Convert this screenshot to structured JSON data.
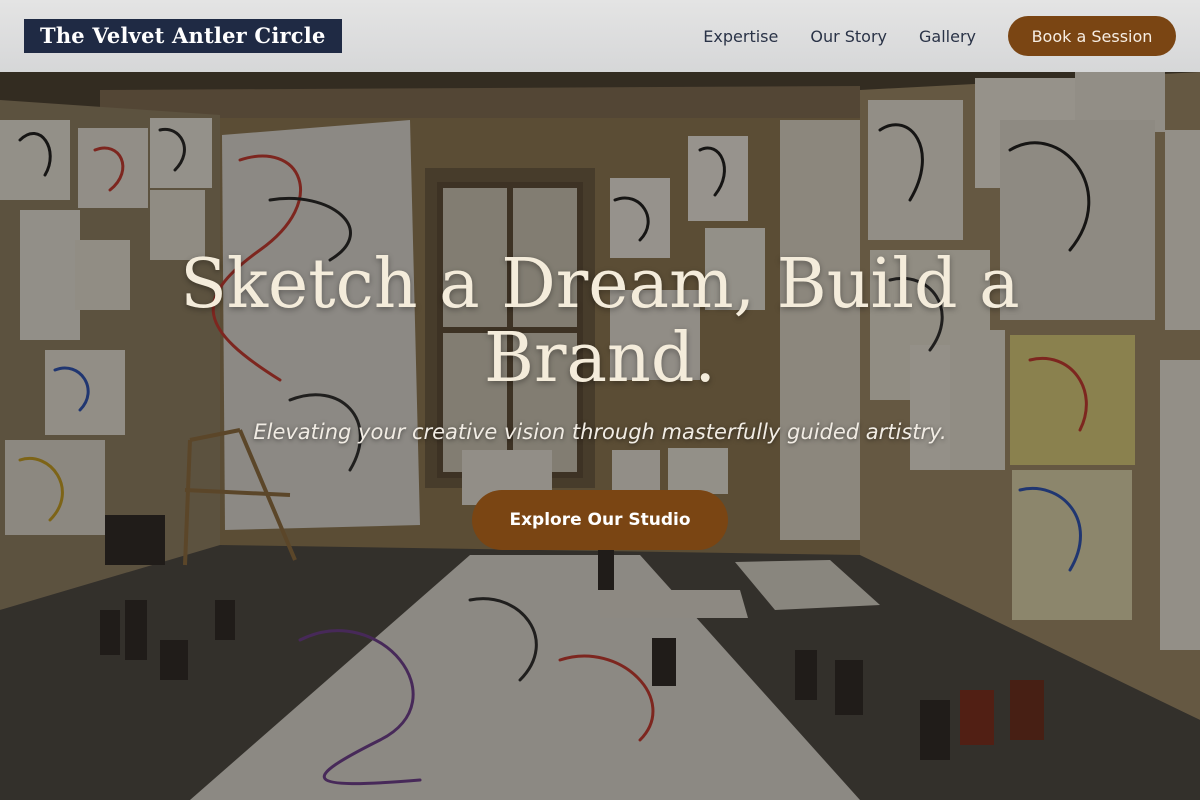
{
  "brand": {
    "name": "The Velvet Antler Circle"
  },
  "nav": {
    "links": [
      "Expertise",
      "Our Story",
      "Gallery"
    ],
    "cta_label": "Book a Session"
  },
  "hero": {
    "headline": "Sketch a Dream, Build a Brand.",
    "tagline": "Elevating your creative vision through masterfully guided artistry.",
    "cta_label": "Explore Our Studio",
    "background": "art-studio-photo"
  },
  "colors": {
    "brand_navy": "#1f2a44",
    "accent_brown": "#7a4513",
    "header_bg": "#dcdcdc",
    "headline_cream": "#f4ecdb"
  }
}
